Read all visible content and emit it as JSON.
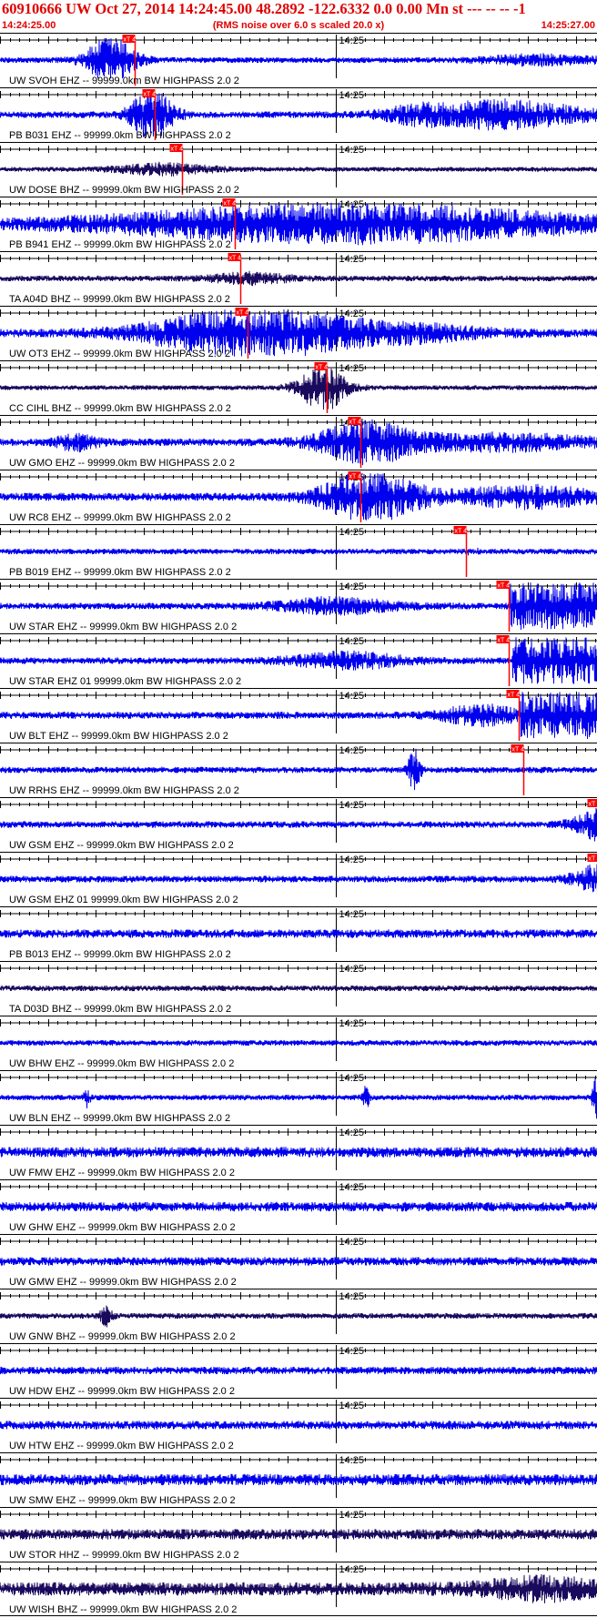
{
  "header": {
    "title": "60910666 UW Oct 27, 2014 14:24:45.00   48.2892 -122.6332  0.0 0.00 Mn st --- -- --  -1",
    "subtitle": "(RMS noise over 6.0 s scaled 20.0 x)",
    "start_time": "14:24:25.00",
    "end_time": "14:25:27.00"
  },
  "colors": {
    "trace_blue": "#0000ee",
    "trace_dark": "#1a0a5e",
    "pick_red": "#ff0000",
    "axis": "#000000",
    "text": "#000000",
    "header_red": "#e00000"
  },
  "chart_data": {
    "type": "seismogram",
    "x_range_seconds": [
      0,
      62
    ],
    "x_tick_label": "14:25",
    "x_tick_label_seconds": 35,
    "minor_tick_interval_seconds": 1,
    "major_tick_interval_seconds": 5,
    "pick_label": "xT 4",
    "traces": [
      {
        "label": "UW SVOH EHZ -- 99999.0km BW  HIGHPASS  2.0  2",
        "pick_s": 14.0,
        "color": "blue",
        "base_amp": 0.12,
        "bursts": [
          [
            11.5,
            2.6,
            0.9
          ],
          [
            56,
            6,
            0.18
          ]
        ]
      },
      {
        "label": "PB B031 EHZ -- 99999.0km BW  HIGHPASS  2.0  2",
        "pick_s": 16.1,
        "color": "blue",
        "base_amp": 0.14,
        "bursts": [
          [
            15.8,
            2.2,
            1.0
          ],
          [
            52,
            9,
            0.55
          ],
          [
            43,
            3,
            0.2
          ]
        ]
      },
      {
        "label": "UW DOSE BHZ -- 99999.0km BW  HIGHPASS  2.0  2",
        "pick_s": 19.0,
        "color": "dark",
        "base_amp": 0.1,
        "bursts": [
          [
            17,
            5,
            0.22
          ]
        ]
      },
      {
        "label": "PB B941 EHZ -- 99999.0km BW  HIGHPASS  2.0  2",
        "pick_s": 24.5,
        "color": "blue",
        "base_amp": 0.16,
        "bursts": [
          [
            36,
            26,
            0.75
          ]
        ]
      },
      {
        "label": "TA A04D BHZ -- 99999.0km BW  HIGHPASS  2.0  2",
        "pick_s": 25.0,
        "color": "dark",
        "base_amp": 0.12,
        "bursts": [
          [
            26,
            4,
            0.2
          ]
        ]
      },
      {
        "label": "UW OT3 EHZ -- 99999.0km BW  HIGHPASS  2.0  2",
        "pick_s": 25.8,
        "color": "blue",
        "base_amp": 0.18,
        "bursts": [
          [
            26,
            10,
            1.0
          ],
          [
            42,
            8,
            0.3
          ]
        ]
      },
      {
        "label": "CC CIHL BHZ -- 99999.0km BW  HIGHPASS  2.0  2",
        "pick_s": 34.0,
        "color": "dark",
        "base_amp": 0.1,
        "bursts": [
          [
            33.5,
            2.5,
            0.95
          ]
        ]
      },
      {
        "label": "UW GMO EHZ -- 99999.0km BW  HIGHPASS  2.0  2",
        "pick_s": 37.5,
        "color": "blue",
        "base_amp": 0.16,
        "bursts": [
          [
            38,
            5,
            0.8
          ],
          [
            8,
            2,
            0.3
          ],
          [
            52,
            10,
            0.3
          ]
        ]
      },
      {
        "label": "UW RC8 EHZ -- 99999.0km BW  HIGHPASS  2.0  2",
        "pick_s": 37.5,
        "color": "blue",
        "base_amp": 0.17,
        "bursts": [
          [
            38.5,
            5,
            1.0
          ],
          [
            55,
            8,
            0.4
          ]
        ]
      },
      {
        "label": "PB B019 EHZ -- 99999.0km BW  HIGHPASS  2.0  2",
        "pick_s": 48.5,
        "color": "blue",
        "base_amp": 0.12,
        "bursts": []
      },
      {
        "label": "UW STAR EHZ -- 99999.0km BW  HIGHPASS  2.0  2",
        "pick_s": 53.0,
        "color": "blue",
        "base_amp": 0.14,
        "bursts": [
          [
            35,
            6,
            0.3
          ]
        ],
        "clipped_after_s": 53.0
      },
      {
        "label": "UW STAR EHZ 01 99999.0km BW  HIGHPASS  2.0  2",
        "pick_s": 53.0,
        "color": "blue",
        "base_amp": 0.14,
        "bursts": [
          [
            36,
            6,
            0.3
          ]
        ],
        "clipped_after_s": 53.2
      },
      {
        "label": "UW BLT EHZ -- 99999.0km BW  HIGHPASS  2.0  2",
        "pick_s": 54.0,
        "color": "blue",
        "base_amp": 0.15,
        "bursts": [
          [
            50,
            4,
            0.4
          ]
        ],
        "clipped_after_s": 54.0
      },
      {
        "label": "UW RRHS EHZ -- 99999.0km BW  HIGHPASS  2.0  2",
        "pick_s": 54.5,
        "color": "blue",
        "base_amp": 0.13,
        "bursts": [
          [
            43,
            0.6,
            0.9
          ]
        ]
      },
      {
        "label": "UW GSM EHZ -- 99999.0km BW  HIGHPASS  2.0  2",
        "pick_s": 62.5,
        "color": "blue",
        "base_amp": 0.14,
        "bursts": [
          [
            63,
            3,
            0.7
          ]
        ]
      },
      {
        "label": "UW GSM EHZ 01 99999.0km BW  HIGHPASS  2.0  2",
        "pick_s": 62.5,
        "color": "blue",
        "base_amp": 0.14,
        "bursts": [
          [
            63,
            3,
            0.7
          ]
        ]
      },
      {
        "label": "PB B013 EHZ -- 99999.0km BW  HIGHPASS  2.0  2",
        "color": "blue",
        "base_amp": 0.18,
        "bursts": []
      },
      {
        "label": "TA D03D BHZ -- 99999.0km BW  HIGHPASS  2.0  2",
        "color": "dark",
        "base_amp": 0.12,
        "bursts": []
      },
      {
        "label": "UW BHW EHZ -- 99999.0km BW  HIGHPASS  2.0  2",
        "color": "blue",
        "base_amp": 0.12,
        "bursts": []
      },
      {
        "label": "UW BLN EHZ -- 99999.0km BW  HIGHPASS  2.0  2",
        "color": "blue",
        "base_amp": 0.12,
        "bursts": [
          [
            62,
            0.5,
            0.9
          ],
          [
            38,
            0.3,
            0.5
          ],
          [
            9,
            0.3,
            0.4
          ]
        ]
      },
      {
        "label": "UW FMW EHZ -- 99999.0km BW  HIGHPASS  2.0  2",
        "color": "blue",
        "base_amp": 0.22,
        "bursts": []
      },
      {
        "label": "UW GHW EHZ -- 99999.0km BW  HIGHPASS  2.0  2",
        "color": "blue",
        "base_amp": 0.2,
        "bursts": []
      },
      {
        "label": "UW GMW EHZ -- 99999.0km BW  HIGHPASS  2.0  2",
        "color": "blue",
        "base_amp": 0.18,
        "bursts": []
      },
      {
        "label": "UW GNW BHZ -- 99999.0km BW  HIGHPASS  2.0  2",
        "color": "dark",
        "base_amp": 0.12,
        "bursts": [
          [
            11,
            0.6,
            0.4
          ]
        ]
      },
      {
        "label": "UW HDW EHZ -- 99999.0km BW  HIGHPASS  2.0  2",
        "color": "blue",
        "base_amp": 0.16,
        "bursts": []
      },
      {
        "label": "UW HTW EHZ -- 99999.0km BW  HIGHPASS  2.0  2",
        "color": "blue",
        "base_amp": 0.18,
        "bursts": []
      },
      {
        "label": "UW SMW EHZ -- 99999.0km BW  HIGHPASS  2.0  2",
        "color": "blue",
        "base_amp": 0.24,
        "bursts": []
      },
      {
        "label": "UW STOR HHZ -- 99999.0km BW  HIGHPASS  2.0  2",
        "color": "dark",
        "base_amp": 0.22,
        "bursts": []
      },
      {
        "label": "UW WISH BHZ -- 99999.0km BW  HIGHPASS  2.0  2",
        "color": "dark",
        "base_amp": 0.28,
        "bursts": [
          [
            56,
            6,
            0.35
          ]
        ]
      }
    ]
  }
}
